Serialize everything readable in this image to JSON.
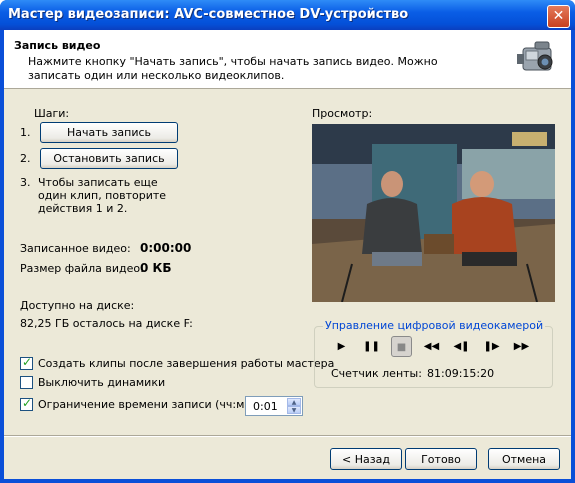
{
  "window": {
    "title": "Мастер видеозаписи: AVC-совместное DV-устройство",
    "close": "✕"
  },
  "header": {
    "title": "Запись видео",
    "description": "Нажмите кнопку \"Начать запись\", чтобы начать запись видео. Можно записать один или несколько видеоклипов."
  },
  "steps": {
    "heading": "Шаги:",
    "n1": "1.",
    "start_button": "Начать запись",
    "n2": "2.",
    "stop_button": "Остановить запись",
    "n3": "3.",
    "step3_text": "Чтобы записать еще один клип, повторите действия 1 и 2."
  },
  "recorded": {
    "label": "Записанное видео:",
    "value": "0:00:00"
  },
  "filesize": {
    "label": "Размер файла видео:",
    "value": "0 КБ"
  },
  "disk": {
    "label": "Доступно на диске:",
    "value": "82,25 ГБ осталось на диске F:"
  },
  "options": [
    {
      "label": "Создать клипы после завершения работы мастера",
      "checked": true
    },
    {
      "label": "Выключить динамики",
      "checked": false
    },
    {
      "label": "Ограничение времени записи (чч:мм):",
      "checked": true
    }
  ],
  "time_limit": {
    "value": "0:01"
  },
  "preview": {
    "label": "Просмотр:"
  },
  "camera": {
    "legend": "Управление цифровой видеокамерой",
    "buttons": [
      "play",
      "pause",
      "stop",
      "rewind",
      "step-back",
      "step-forward",
      "fast-forward"
    ],
    "counter_label": "Счетчик ленты:",
    "counter_value": "81:09:15:20"
  },
  "footer": {
    "back": "< Назад",
    "finish": "Готово",
    "cancel": "Отмена"
  },
  "colors": {
    "titlebar": "#0a5ee6",
    "face": "#ece9d8",
    "legend": "#0046d5",
    "check": "#21a121"
  }
}
